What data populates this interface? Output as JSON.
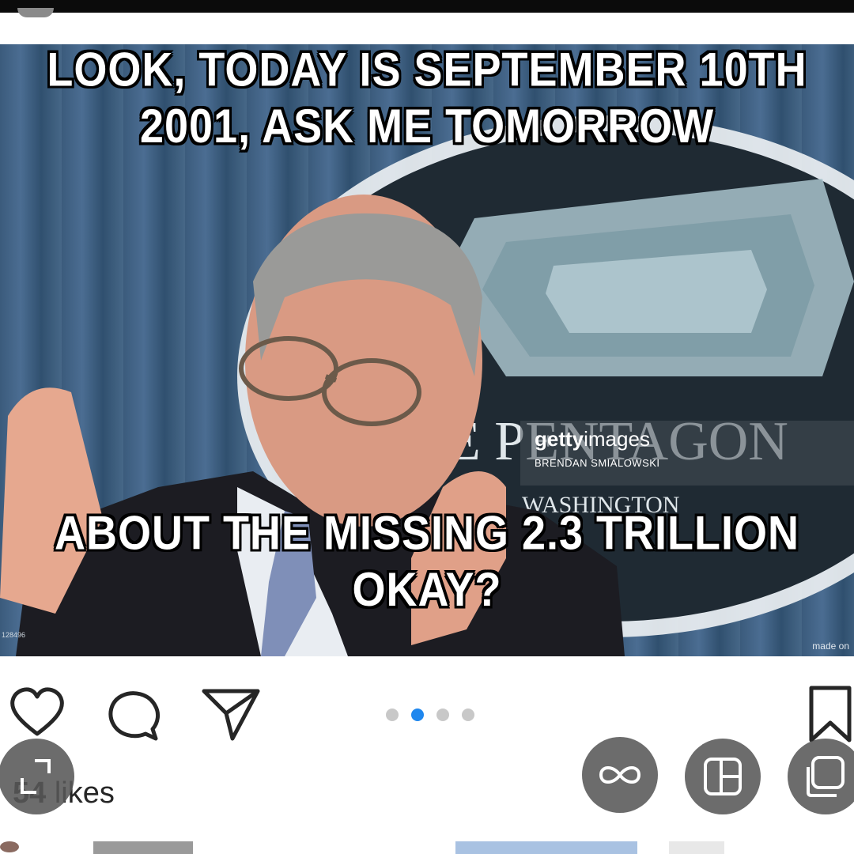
{
  "post": {
    "meme_top_text": "LOOK, TODAY IS SEPTEMBER 10TH 2001, ASK ME TOMORROW",
    "meme_bottom_line1": "ABOUT THE MISSING 2.3 TRILLION",
    "meme_bottom_line2": "OKAY?",
    "seal_text": "E PENTAGON",
    "seal_subtext": "WASHINGTON",
    "watermark_brand_bold": "getty",
    "watermark_brand_rest": "images",
    "watermark_credit": "BRENDAN SMIALOWSKI",
    "corner_id": "128496",
    "made_on": "made on"
  },
  "carousel": {
    "total": 4,
    "active_index": 1,
    "active_color": "#1f87ee",
    "inactive_color": "#c8c8c8"
  },
  "likes": {
    "count": "54",
    "label": "likes"
  },
  "icons": {
    "like": "heart-outline-icon",
    "comment": "speech-bubble-icon",
    "share": "paper-plane-icon",
    "save": "bookmark-outline-icon",
    "resize": "resize-corner-icon",
    "boomerang": "infinity-icon",
    "layout": "layout-grid-icon",
    "multi": "multiple-select-icon"
  },
  "colors": {
    "text": "#262626",
    "fab": "#585858"
  }
}
